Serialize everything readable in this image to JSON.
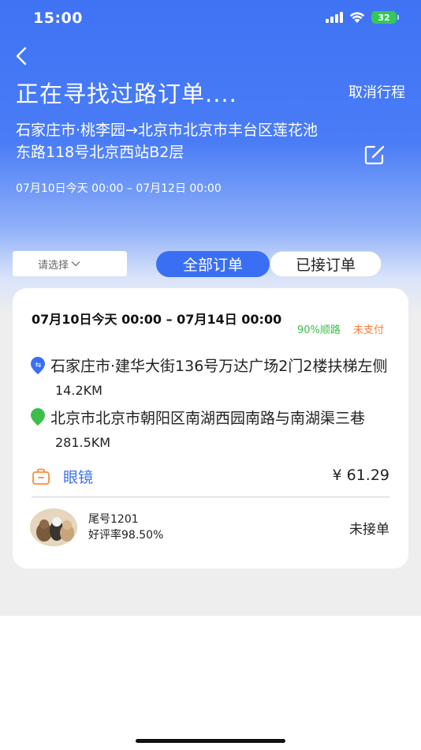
{
  "status_bar": {
    "time": "15:00",
    "battery": "32"
  },
  "header": {
    "title": "正在寻找过路订单....",
    "cancel_label": "取消行程",
    "route_text": "石家庄市·桃李园→北京市北京市丰台区莲花池东路118号北京西站B2层",
    "date_range": "07月10日今天 00:00 – 07月12日 00:00"
  },
  "filter": {
    "select_placeholder": "请选择"
  },
  "tabs": [
    {
      "label": "全部订单",
      "active": true
    },
    {
      "label": "已接订单",
      "active": false
    }
  ],
  "order": {
    "date_range": "07月10日今天 00:00 – 07月14日 00:00",
    "match_tag": "90%顺路",
    "payment_tag": "未支付",
    "start_address": "石家庄市·建华大街136号万达广场2门2楼扶梯左侧",
    "start_distance": "14.2KM",
    "end_address": "北京市北京市朝阳区南湖西园南路与南湖渠三巷",
    "end_distance": "281.5KM",
    "cargo": "眼镜",
    "price": "¥ 61.29",
    "driver_id": "尾号1201",
    "driver_rating": "好评率98.50%",
    "status": "未接单"
  },
  "colors": {
    "primary": "#3a6ff3",
    "match_green": "#3bbf4a",
    "unpaid_orange": "#ff7d3b",
    "battery_green": "#35c759"
  },
  "icons": {
    "back": "back-icon",
    "edit": "edit-icon",
    "start_pin": "start-pin-icon",
    "end_pin": "end-pin-icon",
    "cargo": "bag-icon"
  }
}
